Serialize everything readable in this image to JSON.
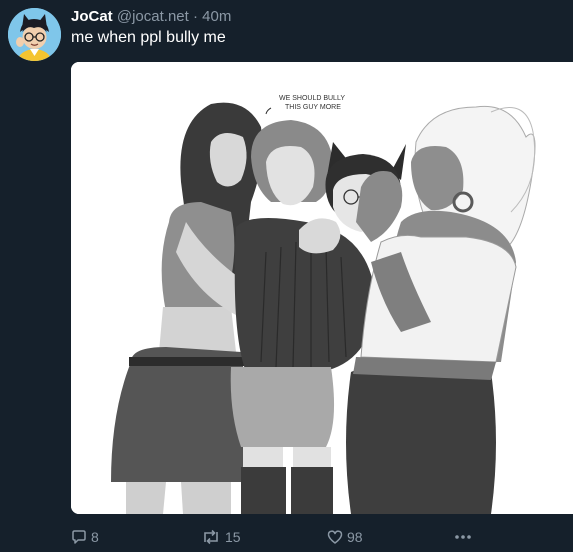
{
  "post": {
    "display_name": "JoCat",
    "handle": "@jocat.net",
    "separator": "·",
    "timestamp": "40m",
    "text": "me when ppl bully me"
  },
  "image": {
    "speech_text_line1": "WE SHOULD BULLY",
    "speech_text_line2": "THIS GUY MORE"
  },
  "actions": {
    "replies": "8",
    "reposts": "15",
    "likes": "98",
    "more_icon": "ellipsis-icon"
  },
  "colors": {
    "background": "#15202b",
    "text_primary": "#ffffff",
    "text_secondary": "#8b98a5",
    "avatar_bg": "#7fc6ea"
  }
}
